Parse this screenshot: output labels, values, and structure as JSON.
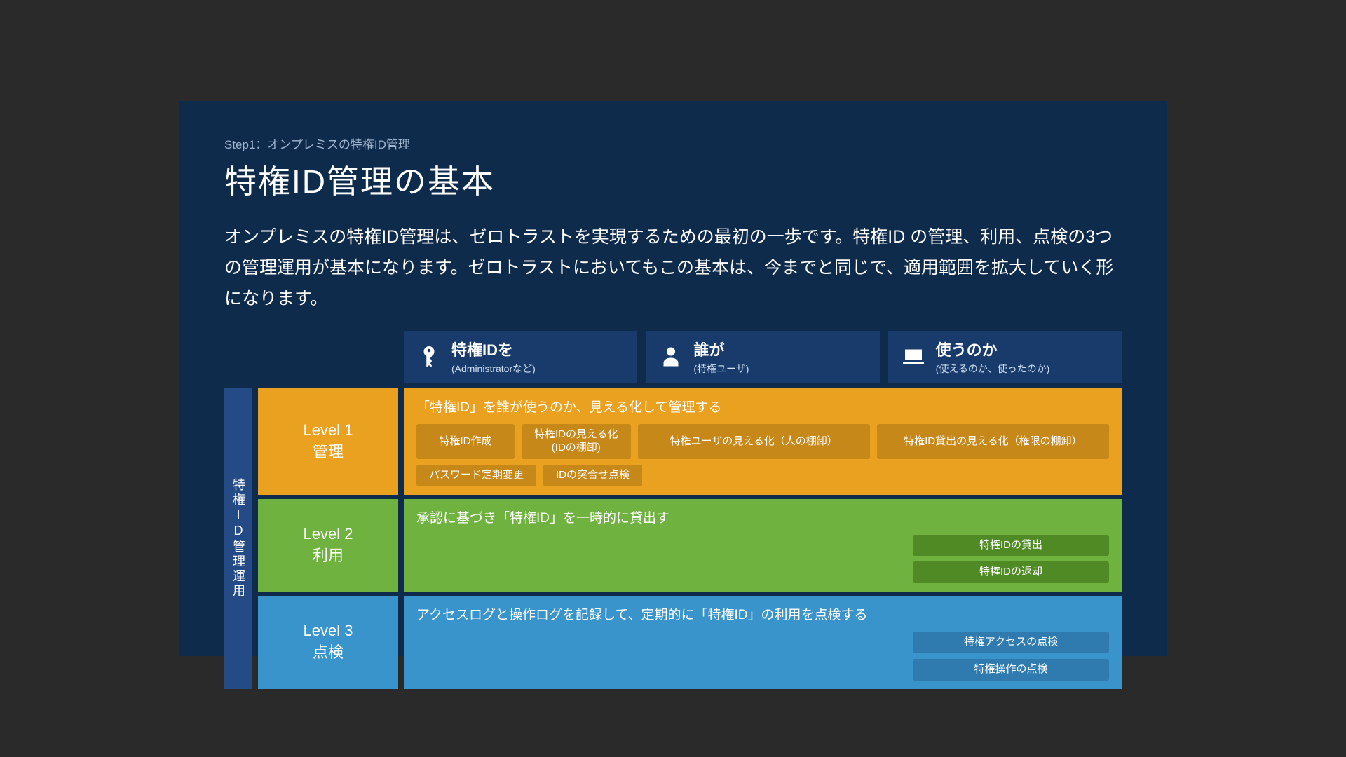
{
  "breadcrumb": "Step1：オンプレミスの特権ID管理",
  "title": "特権ID管理の基本",
  "lead": "オンプレミスの特権ID管理は、ゼロトラストを実現するための最初の一歩です。特権ID の管理、利用、点検の3つの管理運用が基本になります。ゼロトラストにおいてもこの基本は、今までと同じで、適用範囲を拡大していく形になります。",
  "headers": [
    {
      "main": "特権IDを",
      "sub": "(Administratorなど)"
    },
    {
      "main": "誰が",
      "sub": "(特権ユーザ)"
    },
    {
      "main": "使うのか",
      "sub": "(使えるのか、使ったのか)"
    }
  ],
  "sideLabel": "特権ID管理運用",
  "levels": [
    {
      "label1": "Level 1",
      "label2": "管理",
      "desc": "「特権ID」を誰が使うのか、見える化して管理する",
      "chipsRow1": [
        "特権ID作成",
        "特権IDの見える化\n(IDの棚卸)",
        "特権ユーザの見える化（人の棚卸）",
        "特権ID貸出の見える化（権限の棚卸）"
      ],
      "chipsRow2": [
        "パスワード定期変更",
        "IDの突合せ点検"
      ]
    },
    {
      "label1": "Level 2",
      "label2": "利用",
      "desc": "承認に基づき「特権ID」を一時的に貸出す",
      "chipsRight": [
        "特権IDの貸出",
        "特権IDの返却"
      ]
    },
    {
      "label1": "Level 3",
      "label2": "点検",
      "desc": "アクセスログと操作ログを記録して、定期的に「特権ID」の利用を点検する",
      "chipsRight": [
        "特権アクセスの点検",
        "特権操作の点検"
      ]
    }
  ]
}
